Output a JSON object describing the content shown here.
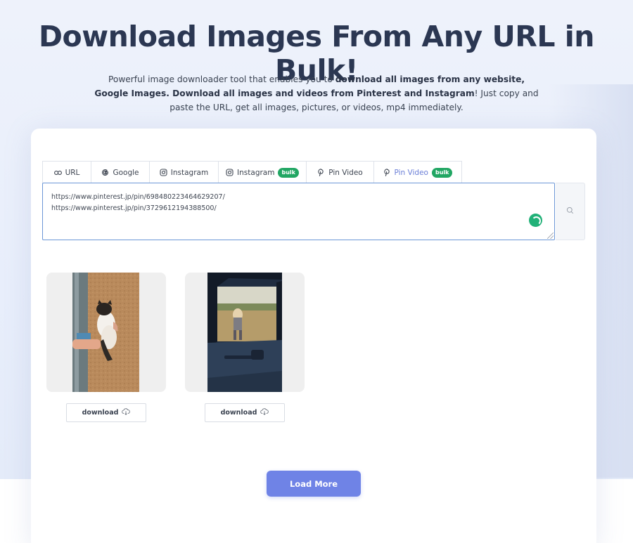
{
  "hero": {
    "title": "Download Images From Any URL in Bulk!",
    "subtitle_parts": {
      "p1": "Powerful image downloader tool that enables you to ",
      "b1": "download all images from any website, Google Images. Download all images and videos from Pinterest and Instagram",
      "p2": "! Just copy and paste the URL, get all images, pictures, or videos, mp4 immediately."
    }
  },
  "tabs": [
    {
      "label": "URL",
      "icon": "link-icon",
      "badge": ""
    },
    {
      "label": "Google",
      "icon": "google-icon",
      "badge": ""
    },
    {
      "label": "Instagram",
      "icon": "instagram-icon",
      "badge": ""
    },
    {
      "label": "Instagram",
      "icon": "instagram-icon",
      "badge": "bulk"
    },
    {
      "label": "Pin Video",
      "icon": "pinterest-icon",
      "badge": ""
    },
    {
      "label": "Pin Video",
      "icon": "pinterest-icon",
      "badge": "bulk",
      "active": true
    }
  ],
  "url_input": {
    "value": "https://www.pinterest.jp/pin/698480223464629207/\nhttps://www.pinterest.jp/pin/3729612194388500/"
  },
  "results": [
    {
      "download_label": "download",
      "image": "cat-held-against-wall-photo"
    },
    {
      "download_label": "download",
      "image": "person-in-field-from-car-photo"
    }
  ],
  "load_more_label": "Load More",
  "colors": {
    "accent": "#6f83e6",
    "badge_green": "#21a663",
    "title": "#2b3752"
  }
}
